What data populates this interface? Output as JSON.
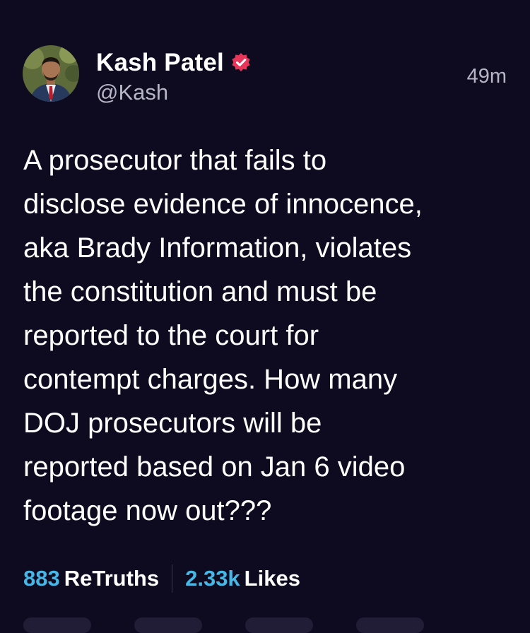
{
  "post": {
    "author": {
      "display_name": "Kash Patel",
      "handle": "@Kash",
      "verified": true,
      "verified_color": "#e8355a"
    },
    "time_ago": "49m",
    "text": "A prosecutor that fails to\ndisclose evidence of innocence,\naka Brady Information, violates\nthe constitution and must be\nreported to the court for\ncontempt charges. How many\nDOJ prosecutors will be\nreported based on Jan 6 video\nfootage now out???",
    "stats": {
      "retruths_count": "883",
      "retruths_label": "ReTruths",
      "likes_count": "2.33k",
      "likes_label": "Likes"
    }
  },
  "colors": {
    "background": "#0e0b20",
    "accent": "#47b7e6",
    "muted_text": "#b6b5c4"
  },
  "icons": {
    "verified": "verified-badge-icon"
  }
}
